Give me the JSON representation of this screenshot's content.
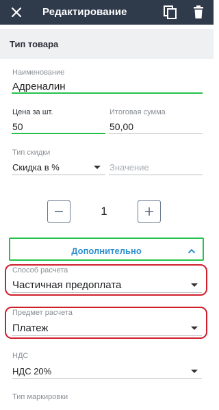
{
  "appbar": {
    "title": "Редактирование"
  },
  "section": {
    "title": "Тип товара"
  },
  "name": {
    "label": "Наименование",
    "value": "Адреналин"
  },
  "price": {
    "label": "Цена за шт.",
    "value": "50"
  },
  "total": {
    "label": "Итоговая сумма",
    "value": "50,00"
  },
  "discount": {
    "label": "Тип скидки",
    "selected": "Скидка в %",
    "value_placeholder": "Значение"
  },
  "quantity": {
    "value": "1"
  },
  "more": {
    "label": "Дополнительно"
  },
  "payment_method": {
    "label": "Способ расчета",
    "selected": "Частичная предоплата"
  },
  "payment_subject": {
    "label": "Предмет расчета",
    "selected": "Платеж"
  },
  "vat": {
    "label": "НДС",
    "selected": "НДС 20%"
  },
  "marking": {
    "label": "Тип маркировки"
  },
  "colors": {
    "appbar": "#2f3a4b",
    "accent_green": "#24c24a",
    "link_blue": "#2d8fcf",
    "highlight_red": "#cf1e2b"
  },
  "icons": [
    "close-icon",
    "copy-icon",
    "trash-icon",
    "chevron-down-icon",
    "chevron-up-icon",
    "minus-icon",
    "plus-icon"
  ]
}
